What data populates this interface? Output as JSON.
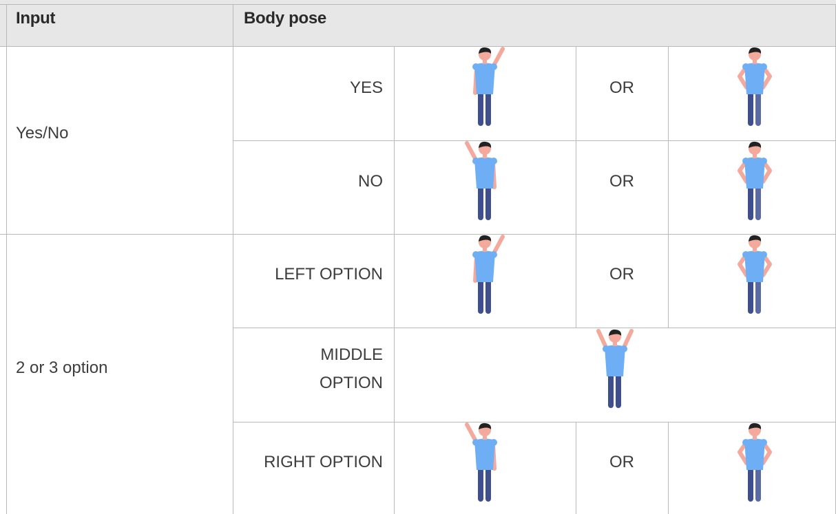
{
  "table": {
    "headers": {
      "input": "Input",
      "body_pose": "Body pose"
    },
    "groups": [
      {
        "input": "Yes/No",
        "rows": [
          {
            "label": "YES",
            "pose_a": "right-arm-raised-figure",
            "or": "OR",
            "pose_b": "hands-on-hips-lean-right-figure"
          },
          {
            "label": "NO",
            "pose_a": "left-arm-raised-figure",
            "or": "OR",
            "pose_b": "hands-on-hips-lean-left-figure"
          }
        ]
      },
      {
        "input": "2 or 3 option",
        "rows": [
          {
            "label": "LEFT OPTION",
            "pose_a": "right-arm-raised-figure",
            "or": "OR",
            "pose_b": "hands-on-hips-lean-right-figure"
          },
          {
            "label_line1": "MIDDLE",
            "label_line2": "OPTION",
            "pose": "both-arms-raised-figure"
          },
          {
            "label": "RIGHT OPTION",
            "pose_a": "left-arm-raised-figure",
            "or": "OR",
            "pose_b": "hands-on-hips-lean-left-figure"
          }
        ]
      }
    ]
  },
  "colors": {
    "header_bg": "#e7e7e7",
    "grid_line": "#b9b9b9",
    "shirt": "#6eaef5",
    "pants": "#3f4f8c",
    "skin": "#f3a99b",
    "hair": "#222222"
  }
}
